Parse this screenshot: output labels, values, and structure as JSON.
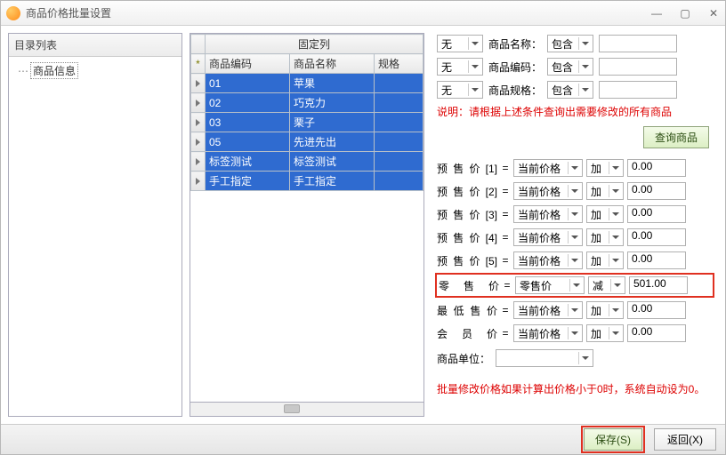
{
  "window": {
    "title": "商品价格批量设置"
  },
  "tree": {
    "header": "目录列表",
    "item": "商品信息"
  },
  "grid": {
    "fixed_label": "固定列",
    "cols": [
      "商品编码",
      "商品名称",
      "规格"
    ],
    "rows": [
      {
        "code": "01",
        "name": "苹果",
        "spec": ""
      },
      {
        "code": "02",
        "name": "巧克力",
        "spec": ""
      },
      {
        "code": "03",
        "name": "栗子",
        "spec": ""
      },
      {
        "code": "05",
        "name": "先进先出",
        "spec": ""
      },
      {
        "code": "标签测试",
        "name": "标签测试",
        "spec": ""
      },
      {
        "code": "手工指定",
        "name": "手工指定",
        "spec": ""
      }
    ]
  },
  "filter": {
    "none": "无",
    "name_label": "商品名称：",
    "code_label": "商品编码：",
    "spec_label": "商品规格：",
    "contain": "包含",
    "note": "说明：请根据上述条件查询出需要修改的所有商品",
    "query_btn": "查询商品"
  },
  "prices": {
    "base_current": "当前价格",
    "base_retail": "零售价",
    "op_add": "加",
    "op_sub": "减",
    "rows": [
      {
        "label": "预售价[1]",
        "base": "当前价格",
        "op": "加",
        "val": "0.00"
      },
      {
        "label": "预售价[2]",
        "base": "当前价格",
        "op": "加",
        "val": "0.00"
      },
      {
        "label": "预售价[3]",
        "base": "当前价格",
        "op": "加",
        "val": "0.00"
      },
      {
        "label": "预售价[4]",
        "base": "当前价格",
        "op": "加",
        "val": "0.00"
      },
      {
        "label": "预售价[5]",
        "base": "当前价格",
        "op": "加",
        "val": "0.00"
      }
    ],
    "retail": {
      "label": "零 售 价",
      "base": "零售价",
      "op": "减",
      "val": "501.00"
    },
    "minprice": {
      "label": "最低售价",
      "base": "当前价格",
      "op": "加",
      "val": "0.00"
    },
    "member": {
      "label": "会 员 价",
      "base": "当前价格",
      "op": "加",
      "val": "0.00"
    },
    "unit_label": "商品单位：",
    "footnote": "批量修改价格如果计算出价格小于0时，系统自动设为0。"
  },
  "footer": {
    "save": "保存(S)",
    "back": "返回(X)"
  }
}
